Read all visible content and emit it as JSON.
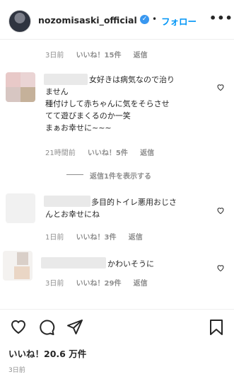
{
  "header": {
    "username": "nozomisaski_official",
    "verified_glyph": "✓",
    "separator": "•",
    "follow_label": "フォロー",
    "more_label": "•••"
  },
  "comments": [
    {
      "time": "3日前",
      "likes": "いいね！15件",
      "reply": "返信"
    },
    {
      "text_lines": [
        "女好きは病気なので治り",
        "ません",
        "種付けして赤ちゃんに気をそらさせ",
        "てて遊びまくるのか一笑",
        "まぁお幸せに~~~"
      ],
      "time": "21時間前",
      "likes": "いいね！5件",
      "reply": "返信"
    },
    {
      "text_lines": [
        "多目的トイレ悪用おじさ",
        "んとお幸せにね"
      ],
      "time": "1日前",
      "likes": "いいね！3件",
      "reply": "返信"
    },
    {
      "text_lines": [
        "かわいそうに"
      ],
      "time": "3日前",
      "likes": "いいね！29件",
      "reply": "返信"
    }
  ],
  "replies_link": "返信1件を表示する",
  "footer": {
    "likes_total": "いいね！20.6 万件",
    "date": "3日前"
  },
  "icons": [
    "heart-icon",
    "comment-icon",
    "share-icon",
    "bookmark-icon",
    "like-comment-icon"
  ],
  "colors": {
    "accent": "#0095f6",
    "verified": "#3897f0",
    "muted": "#8e8e8e",
    "text": "#262626"
  }
}
